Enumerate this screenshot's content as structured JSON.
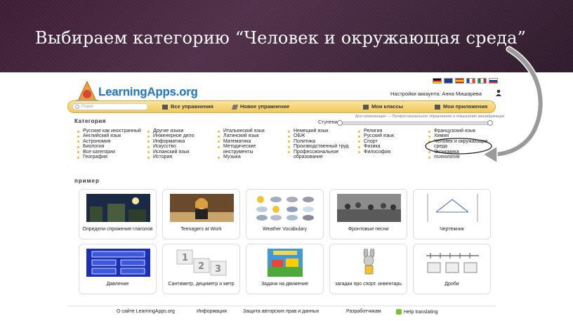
{
  "slide": {
    "title": "Выбираем категорию “Человек и окружающая среда”"
  },
  "app": {
    "logo_text": "LearningApps.org",
    "account_text": "Настройки аккаунта: Анна Мишарева",
    "search_placeholder": "Поиск",
    "nav": {
      "all_exercises": "Все упражнения",
      "new_exercise": "Новое упражнение",
      "my_classes": "Мои классы",
      "my_apps": "Мои приложения"
    },
    "category_title": "Категория",
    "level_note": "Для начинающих — Профессиональное образование и повышение квалификации",
    "level_label": "Ступени:",
    "categories": [
      [
        "Русские как иностранный",
        "Английский язык",
        "Астрономия",
        "Биология",
        "Все категории",
        "География"
      ],
      [
        "Другие языки",
        "Инженерное дело",
        "Информатика",
        "Искусство",
        "Испанский язык",
        "История"
      ],
      [
        "Итальянский язык",
        "Латинский язык",
        "Математика",
        "Методические инструменты",
        "Музыка"
      ],
      [
        "Немецкий язык",
        "ОБЖ",
        "Политика",
        "Производственный труд",
        "Профессиональное образование"
      ],
      [
        "Религия",
        "Русский язык",
        "Спорт",
        "Физика",
        "Философия"
      ],
      [
        "Французский язык",
        "Химия",
        "Человек и окружающая среда",
        "Экономика",
        "психология"
      ]
    ],
    "examples_title": "пример",
    "examples": [
      "Определи спряжение глаголов",
      "Teenagers at Work",
      "Weather Vocabulary",
      "Фронтовые песни",
      "Чертежник",
      "Давление",
      "Сантиметр, дециметр и метр",
      "Задачи на движение",
      "загадки про спорт. инвентарь",
      "Дроби"
    ],
    "footer": {
      "about": "О сайте LearningApps.org",
      "info": "Информация",
      "copyright": "Защита авторских прав и данных",
      "developers": "Разработчикам",
      "help": "Help translating"
    }
  },
  "colors": {
    "header_bg": "#3b1c34",
    "nav_bar": "#f2c85b",
    "logo_blue": "#2a79b8",
    "bullet": "#f0b72c"
  }
}
